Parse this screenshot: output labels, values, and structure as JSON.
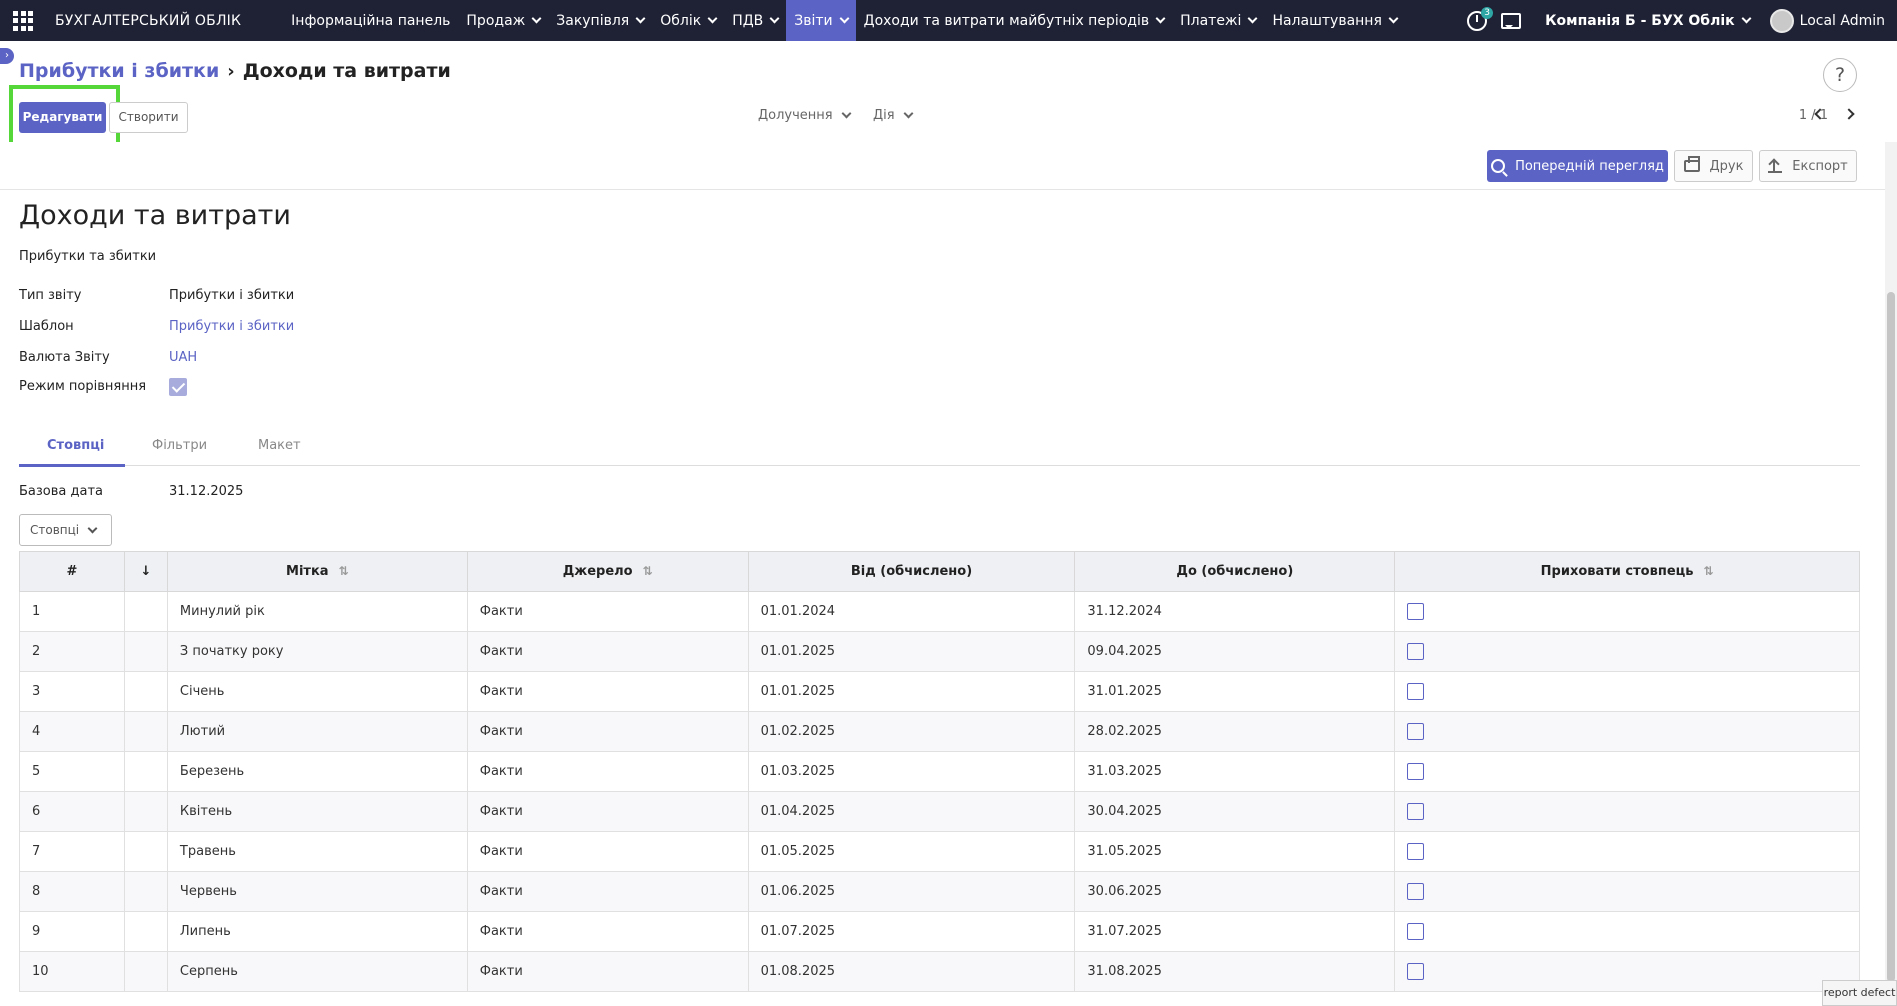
{
  "nav": {
    "brand": "БУХГАЛТЕРСЬКИЙ ОБЛІК",
    "menus": [
      {
        "label": "Інформаційна панель",
        "dropdown": false,
        "active": false
      },
      {
        "label": "Продаж",
        "dropdown": true,
        "active": false
      },
      {
        "label": "Закупівля",
        "dropdown": true,
        "active": false
      },
      {
        "label": "Облік",
        "dropdown": true,
        "active": false
      },
      {
        "label": "ПДВ",
        "dropdown": true,
        "active": false
      },
      {
        "label": "Звіти",
        "dropdown": true,
        "active": true
      },
      {
        "label": "Доходи та витрати майбутніх періодів",
        "dropdown": true,
        "active": false
      },
      {
        "label": "Платежі",
        "dropdown": true,
        "active": false
      },
      {
        "label": "Налаштування",
        "dropdown": true,
        "active": false
      }
    ],
    "activity_count": "3",
    "company": "Компанія Б - БУХ Облік",
    "user": "Local Admin"
  },
  "breadcrumb": {
    "parent": "Прибутки і збитки",
    "current": "Доходи та витрати"
  },
  "toolbar": {
    "edit_label": "Редагувати",
    "create_label": "Створити",
    "attach_label": "Долучення",
    "action_label": "Дія",
    "pager": "1 / 1",
    "help": "?"
  },
  "report_buttons": {
    "preview_label": "Попередній перегляд",
    "print_label": "Друк",
    "export_label": "Експорт"
  },
  "form": {
    "title": "Доходи та витрати",
    "subtitle": "Прибутки та збитки",
    "fields": {
      "report_type_label": "Тип звіту",
      "report_type_value": "Прибутки і збитки",
      "template_label": "Шаблон",
      "template_value": "Прибутки і збитки",
      "currency_label": "Валюта Звіту",
      "currency_value": "UAH",
      "compare_label": "Режим порівняння",
      "compare_value": true
    }
  },
  "tabs": [
    {
      "label": "Стовпці",
      "active": true
    },
    {
      "label": "Фільтри",
      "active": false
    },
    {
      "label": "Макет",
      "active": false
    }
  ],
  "columns_tab": {
    "base_date_label": "Базова дата",
    "base_date_value": "31.12.2025",
    "columns_button": "Стовпці"
  },
  "table": {
    "headers": {
      "num": "#",
      "order": "↓",
      "label": "Мітка",
      "source": "Джерело",
      "from": "Від (обчислено)",
      "to": "До (обчислено)",
      "hide": "Приховати стовпець"
    },
    "rows": [
      {
        "num": "1",
        "label": "Минулий рік",
        "source": "Факти",
        "from": "01.01.2024",
        "to": "31.12.2024",
        "hide": false
      },
      {
        "num": "2",
        "label": "З початку року",
        "source": "Факти",
        "from": "01.01.2025",
        "to": "09.04.2025",
        "hide": false
      },
      {
        "num": "3",
        "label": "Січень",
        "source": "Факти",
        "from": "01.01.2025",
        "to": "31.01.2025",
        "hide": false
      },
      {
        "num": "4",
        "label": "Лютий",
        "source": "Факти",
        "from": "01.02.2025",
        "to": "28.02.2025",
        "hide": false
      },
      {
        "num": "5",
        "label": "Березень",
        "source": "Факти",
        "from": "01.03.2025",
        "to": "31.03.2025",
        "hide": false
      },
      {
        "num": "6",
        "label": "Квітень",
        "source": "Факти",
        "from": "01.04.2025",
        "to": "30.04.2025",
        "hide": false
      },
      {
        "num": "7",
        "label": "Травень",
        "source": "Факти",
        "from": "01.05.2025",
        "to": "31.05.2025",
        "hide": false
      },
      {
        "num": "8",
        "label": "Червень",
        "source": "Факти",
        "from": "01.06.2025",
        "to": "30.06.2025",
        "hide": false
      },
      {
        "num": "9",
        "label": "Липень",
        "source": "Факти",
        "from": "01.07.2025",
        "to": "31.07.2025",
        "hide": false
      },
      {
        "num": "10",
        "label": "Серпень",
        "source": "Факти",
        "from": "01.08.2025",
        "to": "31.08.2025",
        "hide": false
      }
    ]
  },
  "report_defect": "report defect",
  "colors": {
    "nav_bg": "#1f2235",
    "accent": "#5b63c4",
    "highlight": "#55d639"
  }
}
